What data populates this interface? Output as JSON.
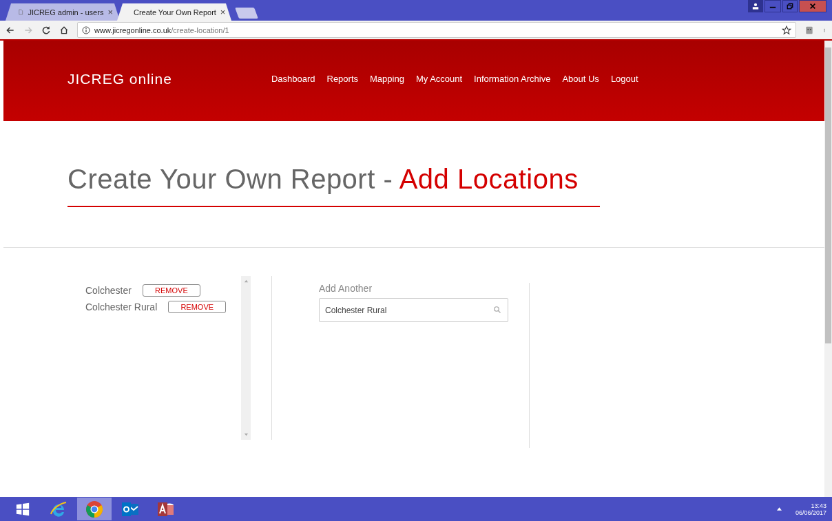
{
  "browser": {
    "tabs": [
      {
        "title": "JICREG admin - users",
        "selected": false
      },
      {
        "title": "Create Your Own Report",
        "selected": true
      }
    ],
    "close_glyph": "×",
    "url_host": "www.jicregonline.co.uk",
    "url_path": "/create-location/1"
  },
  "header": {
    "logo": "JICREG online",
    "nav": [
      "Dashboard",
      "Reports",
      "Mapping",
      "My Account",
      "Information Archive",
      "About Us",
      "Logout"
    ]
  },
  "page": {
    "title_main": "Create Your Own Report - ",
    "title_highlight": "Add Locations"
  },
  "locations": [
    {
      "name": "Colchester",
      "action": "REMOVE"
    },
    {
      "name": "Colchester Rural",
      "action": "REMOVE"
    }
  ],
  "add_another": {
    "label": "Add Another",
    "value": "Colchester Rural"
  },
  "taskbar": {
    "apps": [
      {
        "kind": "ie",
        "selected": false
      },
      {
        "kind": "chrome",
        "selected": true
      },
      {
        "kind": "outlook",
        "selected": false
      },
      {
        "kind": "access",
        "selected": false
      }
    ],
    "time": "13:43",
    "date": "06/06/2017"
  }
}
